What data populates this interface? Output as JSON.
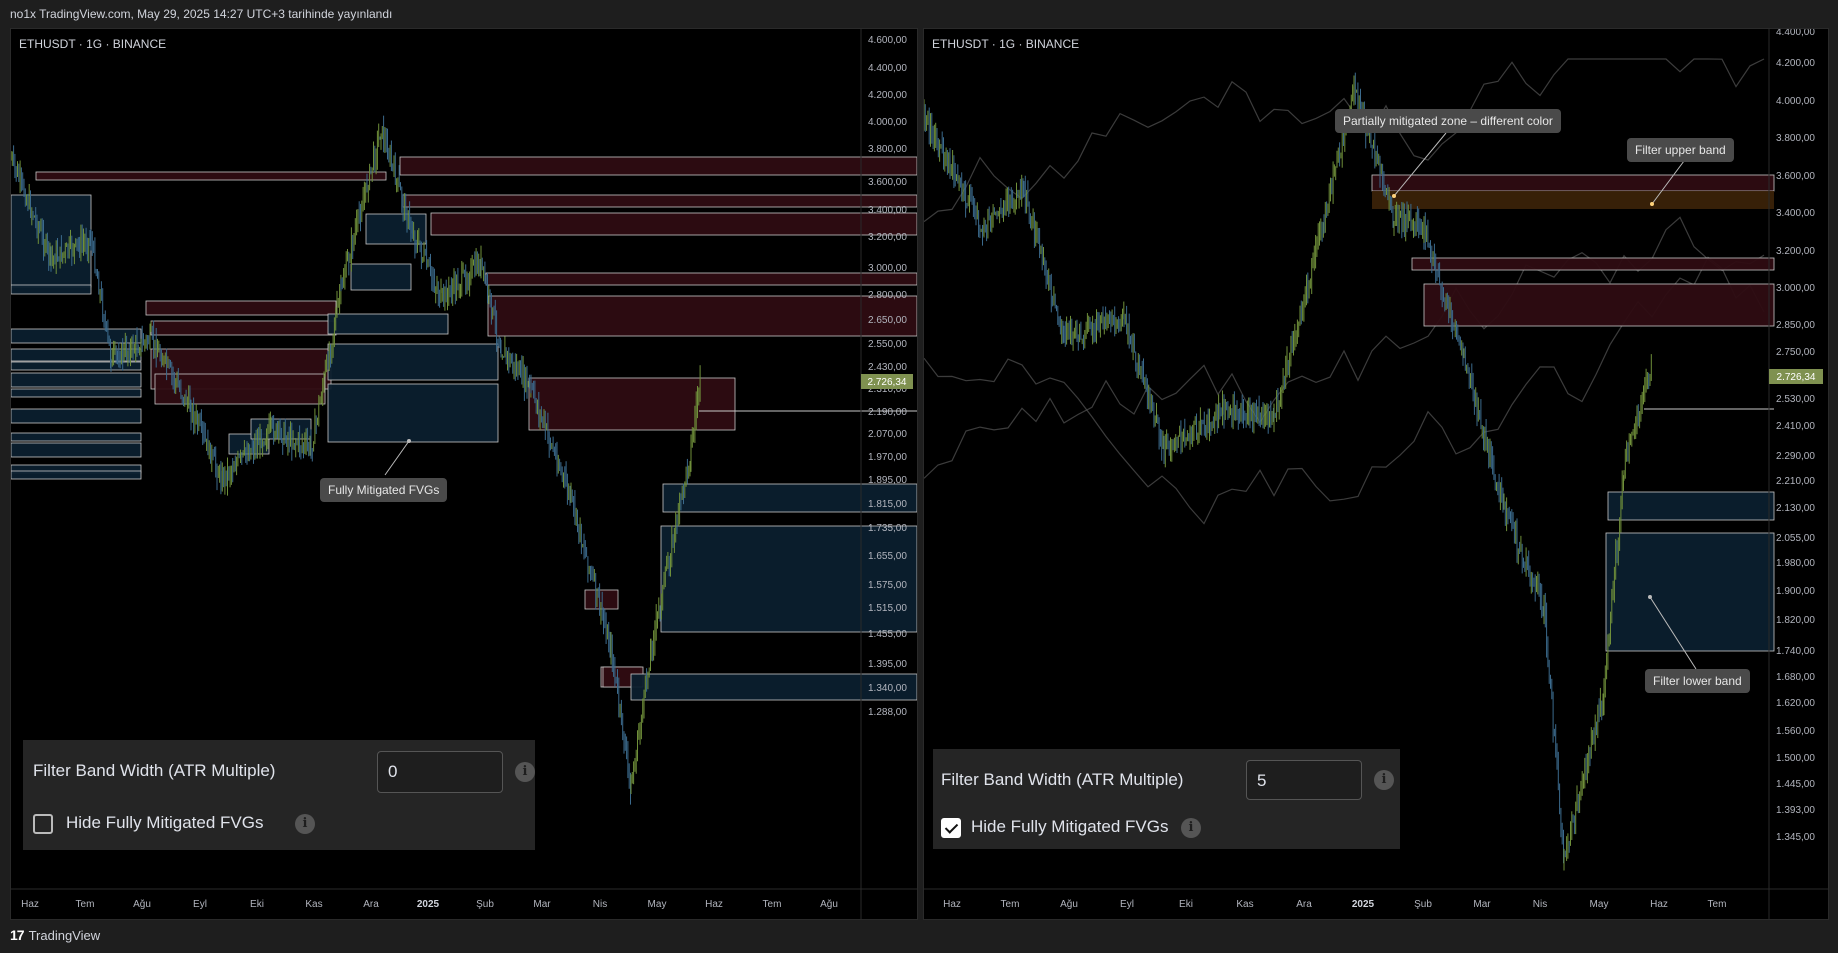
{
  "header": {
    "published_text": "no1x TradingView.com, May 29, 2025 14:27 UTC+3 tarihinde yayınlandı"
  },
  "footer": {
    "brand_logo": "17",
    "brand_name": "TradingView"
  },
  "colors": {
    "bull_zone": "#0b1f2e",
    "bear_zone": "#2e0c12",
    "partial_zone": "#3a2208",
    "price_badge": "#7f9150"
  },
  "panels": [
    {
      "symbol": "ETHUSDT · 1G · BINANCE",
      "last_price": "2.726,34",
      "price_ticks": [
        "4.600,00",
        "4.400,00",
        "4.200,00",
        "4.000,00",
        "3.800,00",
        "3.600,00",
        "3.400,00",
        "3.200,00",
        "3.000,00",
        "2.800,00",
        "2.650,00",
        "2.550,00",
        "2.430,00",
        "2.310,00",
        "2.190,00",
        "2.070,00",
        "1.970,00",
        "1.895,00",
        "1.815,00",
        "1.735,00",
        "1.655,00",
        "1.575,00",
        "1.515,00",
        "1.455,00",
        "1.395,00",
        "1.340,00",
        "1.288,00"
      ],
      "time_ticks": [
        "Haz",
        "Tem",
        "Ağu",
        "Eyl",
        "Eki",
        "Kas",
        "Ara",
        "2025",
        "Şub",
        "Mar",
        "Nis",
        "May",
        "Haz",
        "Tem",
        "Ağu"
      ],
      "settings": {
        "filter_label": "Filter Band Width (ATR Multiple)",
        "filter_value": "0",
        "hide_label": "Hide Fully Mitigated FVGs",
        "hide_checked": false
      },
      "annotations": [
        {
          "text": "Fully Mitigated FVGs"
        }
      ]
    },
    {
      "symbol": "ETHUSDT · 1G · BINANCE",
      "last_price": "2.726,34",
      "price_ticks": [
        "4.400,00",
        "4.200,00",
        "4.000,00",
        "3.800,00",
        "3.600,00",
        "3.400,00",
        "3.200,00",
        "3.000,00",
        "2.850,00",
        "2.750,00",
        "2.650,00",
        "2.530,00",
        "2.410,00",
        "2.290,00",
        "2.210,00",
        "2.130,00",
        "2.055,00",
        "1.980,00",
        "1.900,00",
        "1.820,00",
        "1.740,00",
        "1.680,00",
        "1.620,00",
        "1.560,00",
        "1.500,00",
        "1.445,00",
        "1.393,00",
        "1.345,00"
      ],
      "time_ticks": [
        "Haz",
        "Tem",
        "Ağu",
        "Eyl",
        "Eki",
        "Kas",
        "Ara",
        "2025",
        "Şub",
        "Mar",
        "Nis",
        "May",
        "Haz",
        "Tem"
      ],
      "settings": {
        "filter_label": "Filter Band Width (ATR Multiple)",
        "filter_value": "5",
        "hide_label": "Hide Fully Mitigated FVGs",
        "hide_checked": true
      },
      "annotations": [
        {
          "text": "Partially mitigated zone – different color"
        },
        {
          "text": "Filter upper band"
        },
        {
          "text": "Filter lower band"
        }
      ]
    }
  ]
}
